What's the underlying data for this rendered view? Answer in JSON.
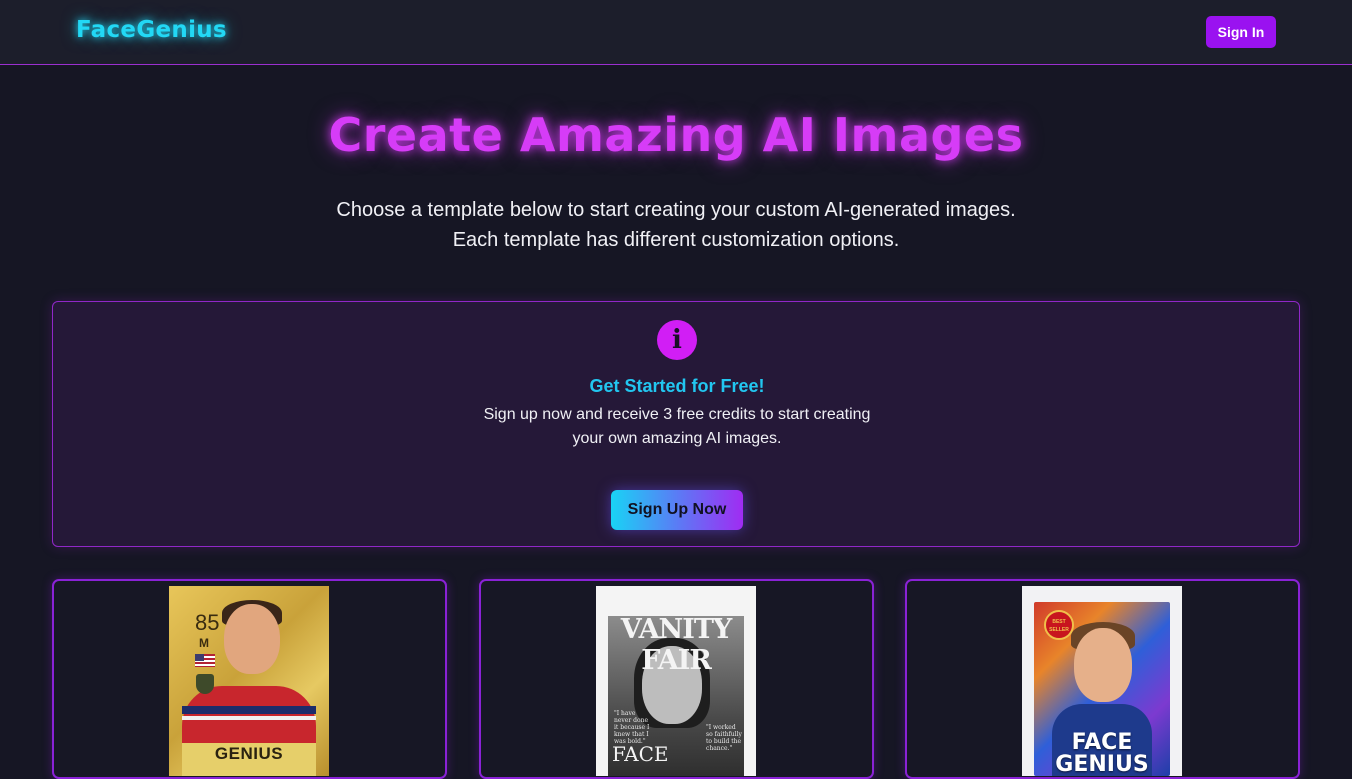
{
  "header": {
    "logo": "FaceGenius",
    "sign_in_label": "Sign In"
  },
  "hero": {
    "title": "Create Amazing AI Images",
    "subtitle_line1": "Choose a template below to start creating your custom AI-generated images.",
    "subtitle_line2": "Each template has different customization options."
  },
  "promo": {
    "icon": "info-icon",
    "icon_glyph": "i",
    "title": "Get Started for Free!",
    "text": "Sign up now and receive 3 free credits to start creating your own amazing AI images.",
    "button_label": "Sign Up Now"
  },
  "templates": [
    {
      "kind": "player-card",
      "rating": "85",
      "position": "M",
      "name_text": "GENIUS"
    },
    {
      "kind": "magazine-cover",
      "masthead": "VANITY FAIR",
      "quote_left": "\"I have never done it because I knew that I was bold.\"",
      "quote_right": "\"I worked so faithfully to build the chance.\"",
      "cover_word": "FACE"
    },
    {
      "kind": "book-cover",
      "seal_text": "BEST SELLER",
      "title_text": "FACE GENIUS"
    }
  ],
  "colors": {
    "background": "#161624",
    "header": "#1c1e2b",
    "logo": "#22d8f5",
    "accent_purple": "#9a12f0",
    "hero_title": "#d63cf7",
    "promo_title": "#22c6f0",
    "info_icon": "#d11ef5"
  }
}
